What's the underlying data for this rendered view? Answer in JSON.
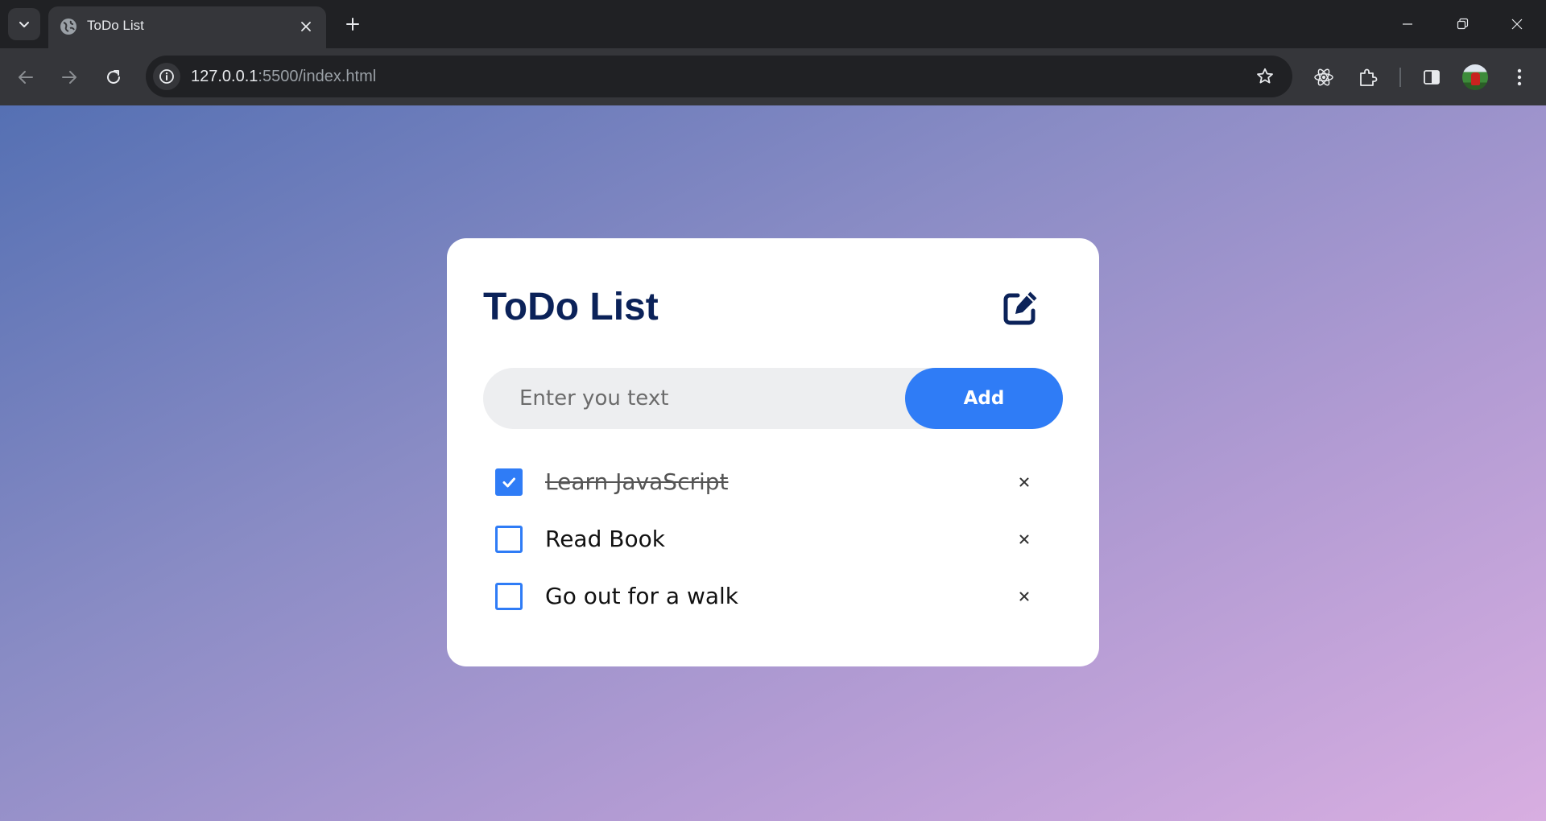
{
  "browser": {
    "tab": {
      "title": "ToDo List"
    },
    "address_bar": {
      "host": "127.0.0.1",
      "path": ":5500/index.html"
    }
  },
  "app": {
    "title": "ToDo List",
    "input": {
      "placeholder": "Enter you text",
      "value": ""
    },
    "add_button_label": "Add",
    "items": [
      {
        "text": "Learn JavaScript",
        "completed": true,
        "remove_label": "×"
      },
      {
        "text": "Read Book",
        "completed": false,
        "remove_label": "×"
      },
      {
        "text": "Go out for a walk",
        "completed": false,
        "remove_label": "×"
      }
    ]
  },
  "colors": {
    "accent": "#2f7cf6",
    "title": "#0b2259",
    "gradient_start": "#5570b3",
    "gradient_end": "#d8aee1",
    "chrome_dark": "#202124",
    "chrome_toolbar": "#35363a"
  },
  "icons": {
    "browser": [
      "tab-search-icon",
      "globe-icon",
      "close-icon",
      "plus-icon",
      "minimize-icon",
      "restore-icon",
      "back-arrow-icon",
      "forward-arrow-icon",
      "reload-icon",
      "info-icon",
      "star-icon",
      "react-icon",
      "puzzle-icon",
      "side-panel-icon",
      "kebab-menu-icon"
    ],
    "app": [
      "edit-icon",
      "checkmark-icon"
    ]
  }
}
